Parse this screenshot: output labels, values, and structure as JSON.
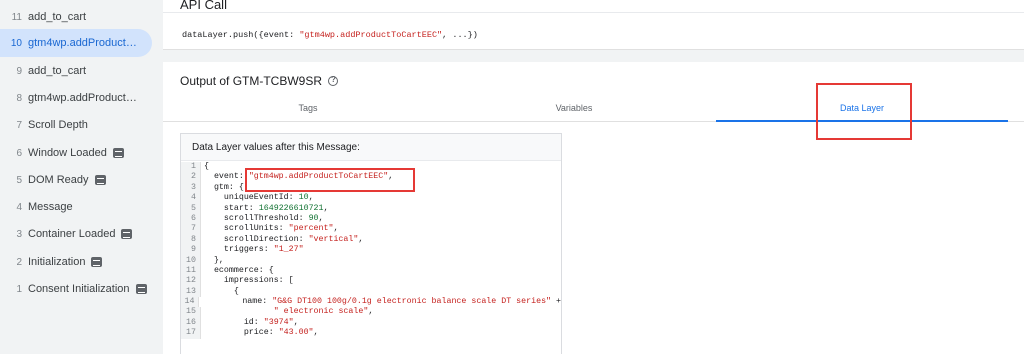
{
  "sidebar": {
    "items": [
      {
        "num": "11",
        "label": "add_to_cart",
        "badge": false,
        "active": false
      },
      {
        "num": "10",
        "label": "gtm4wp.addProductTo...",
        "badge": false,
        "active": true
      },
      {
        "num": "9",
        "label": "add_to_cart",
        "badge": false,
        "active": false
      },
      {
        "num": "8",
        "label": "gtm4wp.addProductTo...",
        "badge": false,
        "active": false
      },
      {
        "num": "7",
        "label": "Scroll Depth",
        "badge": false,
        "active": false
      },
      {
        "num": "6",
        "label": "Window Loaded",
        "badge": true,
        "active": false
      },
      {
        "num": "5",
        "label": "DOM Ready",
        "badge": true,
        "active": false
      },
      {
        "num": "4",
        "label": "Message",
        "badge": false,
        "active": false
      },
      {
        "num": "3",
        "label": "Container Loaded",
        "badge": true,
        "active": false
      },
      {
        "num": "2",
        "label": "Initialization",
        "badge": true,
        "active": false
      },
      {
        "num": "1",
        "label": "Consent Initialization",
        "badge": true,
        "active": false
      }
    ],
    "badge_icon": "gtm-tag-icon"
  },
  "api_call": {
    "title": "API Call",
    "code_prefix": "dataLayer.push({event: ",
    "code_string": "\"gtm4wp.addProductToCartEEC\"",
    "code_suffix": ", ...})"
  },
  "output": {
    "title": "Output of GTM-TCBW9SR",
    "tabs": [
      {
        "label": "Tags",
        "active": false
      },
      {
        "label": "Variables",
        "active": false
      },
      {
        "label": "Data Layer",
        "active": true
      }
    ],
    "datalayer_heading": "Data Layer values after this Message:",
    "code_lines": [
      {
        "num": "1",
        "parts": [
          [
            "t",
            "{"
          ]
        ]
      },
      {
        "num": "2",
        "parts": [
          [
            "t",
            "  event: "
          ],
          [
            "s",
            "\"gtm4wp.addProductToCartEEC\""
          ],
          [
            "t",
            ","
          ]
        ]
      },
      {
        "num": "3",
        "parts": [
          [
            "t",
            "  gtm: {"
          ]
        ]
      },
      {
        "num": "4",
        "parts": [
          [
            "t",
            "    uniqueEventId: "
          ],
          [
            "n",
            "10"
          ],
          [
            "t",
            ","
          ]
        ]
      },
      {
        "num": "5",
        "parts": [
          [
            "t",
            "    start: "
          ],
          [
            "n",
            "1649226610721"
          ],
          [
            "t",
            ","
          ]
        ]
      },
      {
        "num": "6",
        "parts": [
          [
            "t",
            "    scrollThreshold: "
          ],
          [
            "n",
            "90"
          ],
          [
            "t",
            ","
          ]
        ]
      },
      {
        "num": "7",
        "parts": [
          [
            "t",
            "    scrollUnits: "
          ],
          [
            "s",
            "\"percent\""
          ],
          [
            "t",
            ","
          ]
        ]
      },
      {
        "num": "8",
        "parts": [
          [
            "t",
            "    scrollDirection: "
          ],
          [
            "s",
            "\"vertical\""
          ],
          [
            "t",
            ","
          ]
        ]
      },
      {
        "num": "9",
        "parts": [
          [
            "t",
            "    triggers: "
          ],
          [
            "s",
            "\"1_27\""
          ]
        ]
      },
      {
        "num": "10",
        "parts": [
          [
            "t",
            "  },"
          ]
        ]
      },
      {
        "num": "11",
        "parts": [
          [
            "t",
            "  ecommerce: {"
          ]
        ]
      },
      {
        "num": "12",
        "parts": [
          [
            "t",
            "    impressions: ["
          ]
        ]
      },
      {
        "num": "13",
        "parts": [
          [
            "t",
            "      {"
          ]
        ]
      },
      {
        "num": "14",
        "parts": [
          [
            "t",
            "        name: "
          ],
          [
            "s",
            "\"G&G DT100 100g/0.1g electronic balance scale DT series\""
          ],
          [
            "t",
            " +"
          ]
        ]
      },
      {
        "num": "15",
        "parts": [
          [
            "t",
            "              "
          ],
          [
            "s",
            "\" electronic scale\""
          ],
          [
            "t",
            ","
          ]
        ]
      },
      {
        "num": "16",
        "parts": [
          [
            "t",
            "        id: "
          ],
          [
            "s",
            "\"3974\""
          ],
          [
            "t",
            ","
          ]
        ]
      },
      {
        "num": "17",
        "parts": [
          [
            "t",
            "        price: "
          ],
          [
            "s",
            "\"43.00\""
          ],
          [
            "t",
            ","
          ]
        ]
      }
    ]
  },
  "colors": {
    "accent": "#1a73e8",
    "active_bg": "#d2e3fc",
    "highlight_box": "#e53935",
    "string": "#c5221f",
    "number": "#137333"
  }
}
